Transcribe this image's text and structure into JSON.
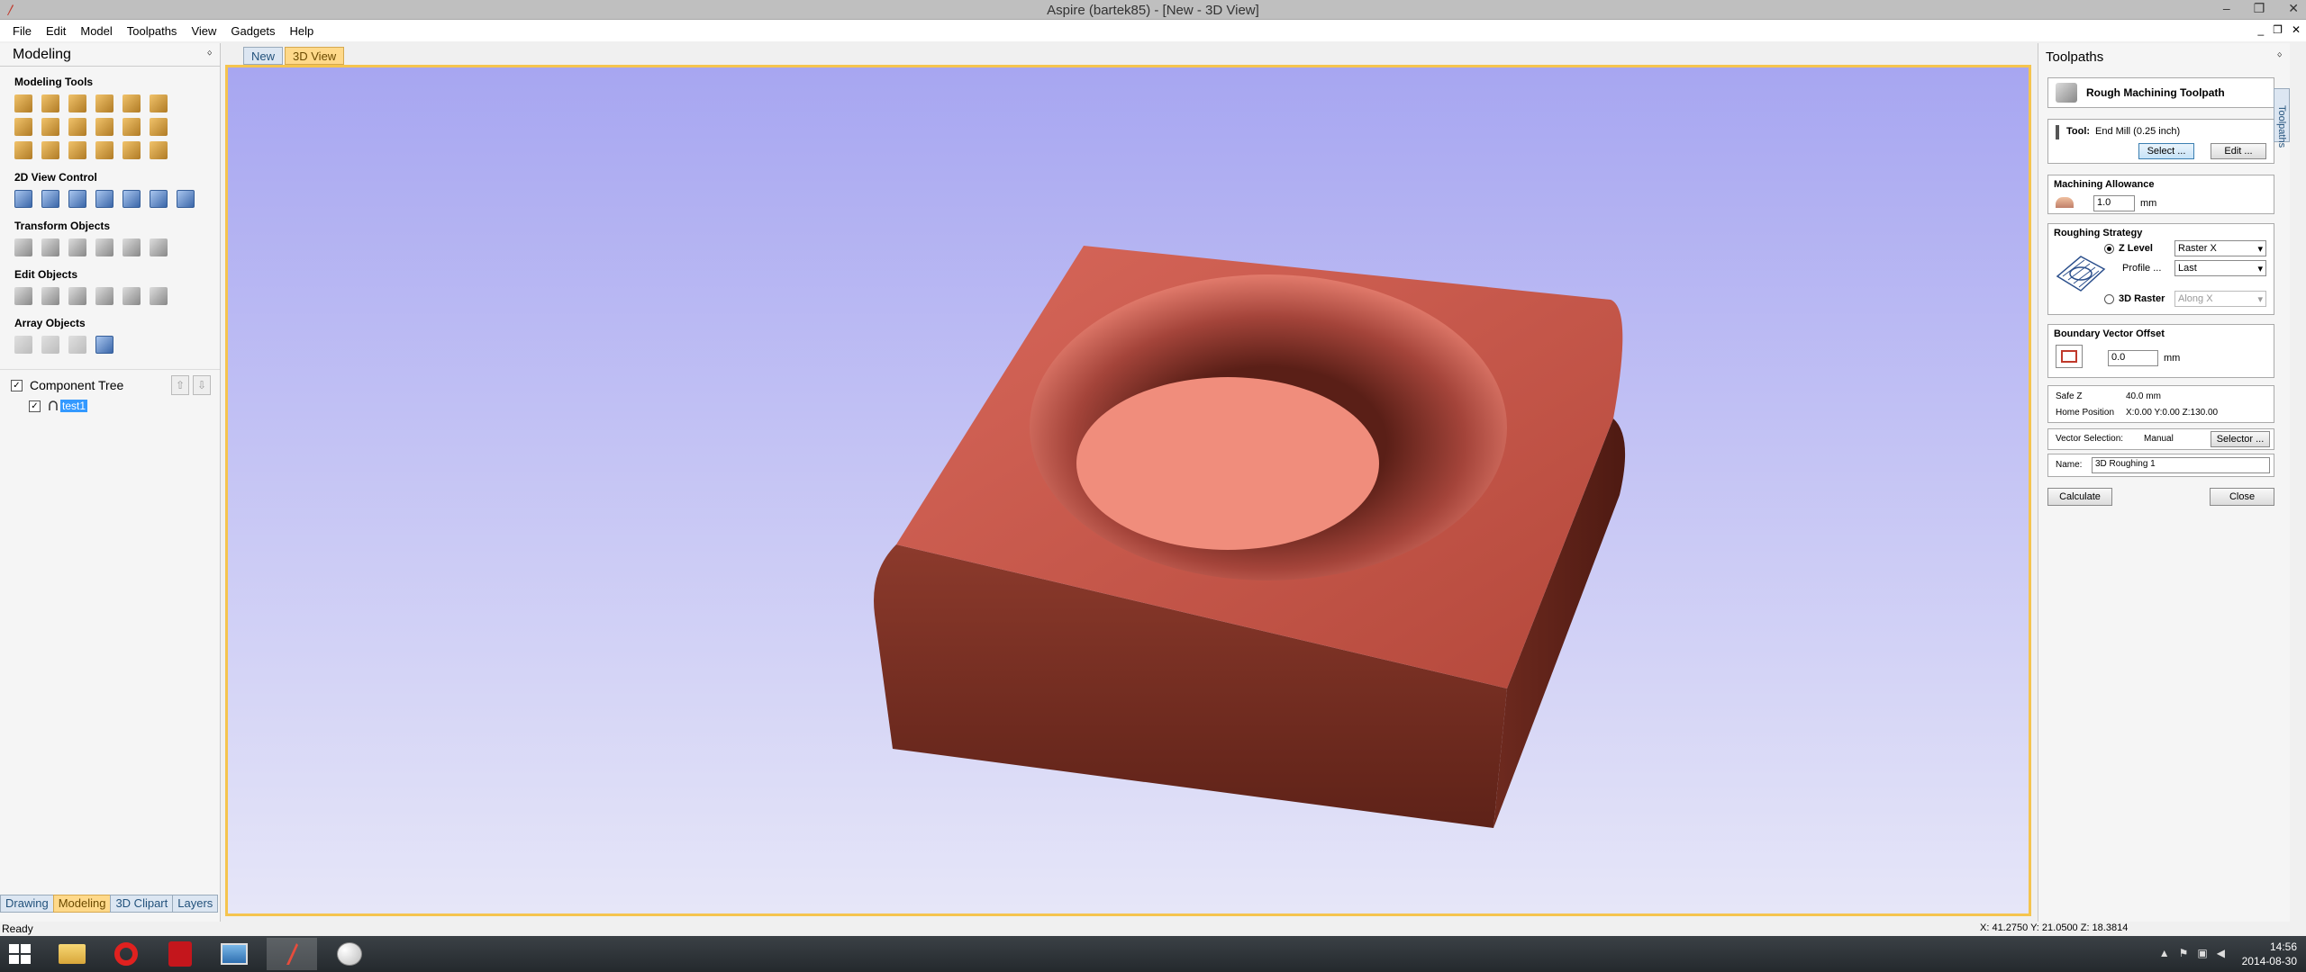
{
  "window": {
    "title": "Aspire (bartek85) - [New - 3D View]",
    "buttons": [
      "–",
      "❐",
      "✕"
    ]
  },
  "menu": {
    "items": [
      "File",
      "Edit",
      "Model",
      "Toolpaths",
      "View",
      "Gadgets",
      "Help"
    ],
    "mdi_buttons": [
      "_",
      "❐",
      "✕"
    ]
  },
  "left_panel": {
    "title": "Modeling",
    "pin": "ᛜ",
    "sections": {
      "modeling_tools": "Modeling Tools",
      "view_control": "2D View Control",
      "transform": "Transform Objects",
      "edit": "Edit Objects",
      "array": "Array Objects"
    },
    "component_tree": {
      "label": "Component Tree",
      "checked": "✓",
      "up": "⇧",
      "down": "⇩",
      "item": "test1"
    },
    "bottom_tabs": [
      "Drawing",
      "Modeling",
      "3D Clipart",
      "Layers"
    ],
    "active_bottom_tab": "Modeling"
  },
  "doc_tabs": {
    "items": [
      "New",
      "3D View"
    ],
    "active": "3D View"
  },
  "right_panel": {
    "title": "Toolpaths",
    "pin": "ᛜ",
    "side_tab": "Toolpaths",
    "heading": "Rough Machining Toolpath",
    "tool": {
      "label": "Tool:",
      "value": "End Mill (0.25 inch)",
      "select_btn": "Select ...",
      "edit_btn": "Edit ..."
    },
    "machining_allowance": {
      "title": "Machining Allowance",
      "value": "1.0",
      "unit": "mm"
    },
    "roughing_strategy": {
      "title": "Roughing Strategy",
      "z_level": "Z Level",
      "z_level_select": "Raster X",
      "profile": "Profile ...",
      "profile_select": "Last",
      "raster_3d": "3D Raster",
      "raster_select": "Along X"
    },
    "boundary": {
      "title": "Boundary Vector Offset",
      "value": "0.0",
      "unit": "mm"
    },
    "safe_z": {
      "label": "Safe Z",
      "value": "40.0 mm"
    },
    "home_position": {
      "label": "Home Position",
      "value": "X:0.00 Y:0.00 Z:130.00"
    },
    "vector_selection": {
      "label": "Vector Selection:",
      "value": "Manual",
      "button": "Selector ..."
    },
    "name": {
      "label": "Name:",
      "value": "3D Roughing 1"
    },
    "calculate": "Calculate",
    "close": "Close"
  },
  "status": {
    "left": "Ready",
    "coords": "X: 41.2750 Y: 21.0500 Z: 18.3814"
  },
  "taskbar": {
    "time": "14:56",
    "date": "2014-08-30",
    "tray_arrow": "▲"
  }
}
